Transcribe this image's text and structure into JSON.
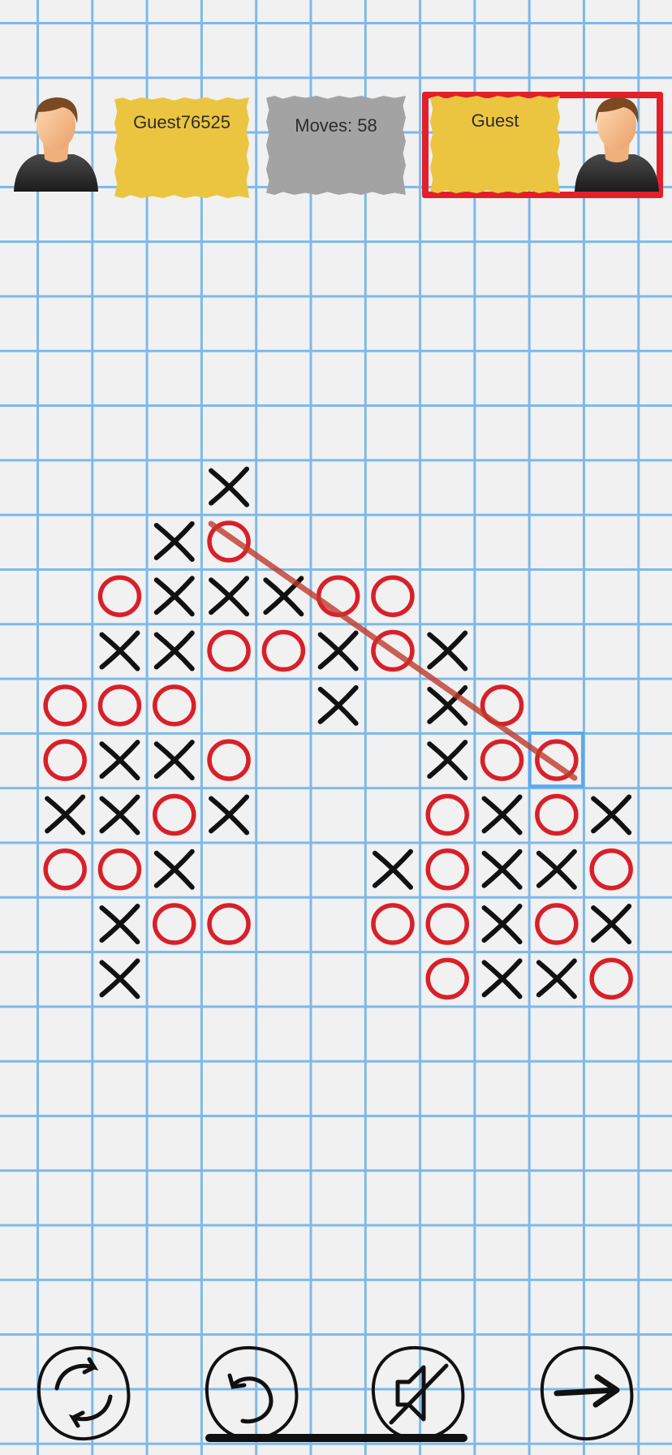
{
  "players": {
    "left": {
      "name": "Guest76525",
      "avatar_icon": "person-avatar-icon"
    },
    "right": {
      "name": "Guest",
      "avatar_icon": "person-avatar-icon",
      "is_active": true
    }
  },
  "moves_label": "Moves: 58",
  "colors": {
    "x_mark": "#111111",
    "o_mark": "#d8202a",
    "win_line": "#c0392b",
    "grid": "#7db9ea",
    "paper": "#ecc540",
    "active": "#e1202a",
    "highlight": "#5aa9ef"
  },
  "board": {
    "rows": [
      "...X.......",
      "..XO.......",
      ".OXXXOO....",
      ".XXOOXOX...",
      "OOO..X.XO..",
      "OXXO...XOO.",
      "XXOX...OXOX",
      "OOX...XOXXO",
      ".XOO..OOXOX",
      ".X.....OXXO"
    ],
    "last_move": {
      "row": 5,
      "col": 9
    },
    "win_line": {
      "from": {
        "row": 1,
        "col": 3
      },
      "to": {
        "row": 5,
        "col": 9
      }
    }
  },
  "controls": [
    {
      "name": "restart-icon"
    },
    {
      "name": "undo-icon"
    },
    {
      "name": "mute-icon"
    },
    {
      "name": "next-arrow-icon"
    }
  ]
}
